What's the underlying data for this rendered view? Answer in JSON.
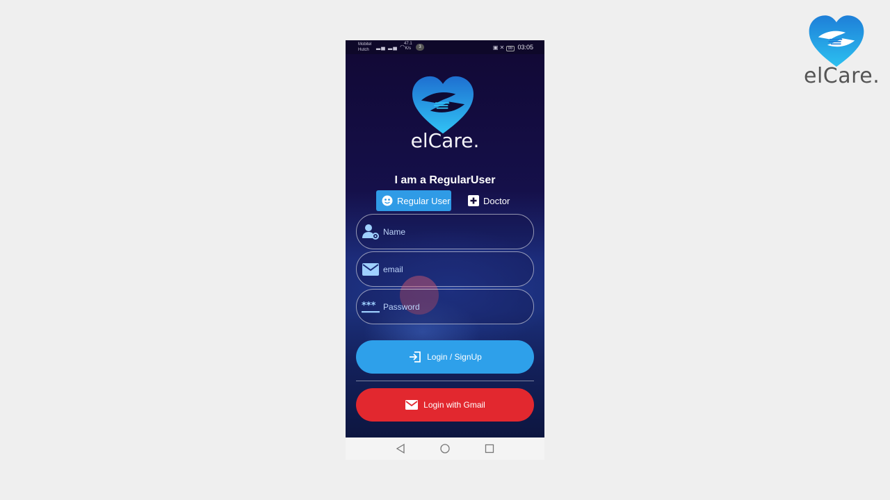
{
  "corner": {
    "brand": "elCare."
  },
  "status_bar": {
    "carrier_1": "Mobitel",
    "carrier_2": "Hutch",
    "speed_value": "47.1",
    "speed_unit": "K/s",
    "badge": "3",
    "battery": "98",
    "time": "03:05"
  },
  "app": {
    "brand": "elCare.",
    "role_title": "I am a RegularUser",
    "roles": [
      {
        "label": "Regular User",
        "selected": true
      },
      {
        "label": "Doctor",
        "selected": false
      }
    ],
    "fields": {
      "name": {
        "placeholder": "Name",
        "value": ""
      },
      "email": {
        "placeholder": "email",
        "value": ""
      },
      "password": {
        "placeholder": "Password",
        "value": ""
      }
    },
    "login_button": "Login / SignUp",
    "gmail_button": "Login with Gmail"
  },
  "icons": {
    "corner_logo": "heart-hands-logo",
    "app_logo": "heart-hands-logo",
    "regular_user": "user-face-icon",
    "doctor": "medical-cross-icon",
    "name": "user-settings-icon",
    "email": "mail-icon",
    "password": "password-dots-icon",
    "login": "login-arrow-icon",
    "gmail": "mail-icon",
    "nav_back": "triangle-back-icon",
    "nav_home": "circle-home-icon",
    "nav_recent": "square-recent-icon"
  },
  "colors": {
    "primary_blue": "#2ea0ea",
    "gmail_red": "#e2282f",
    "background_dark": "#140c3a",
    "page_bg": "#efefef"
  }
}
